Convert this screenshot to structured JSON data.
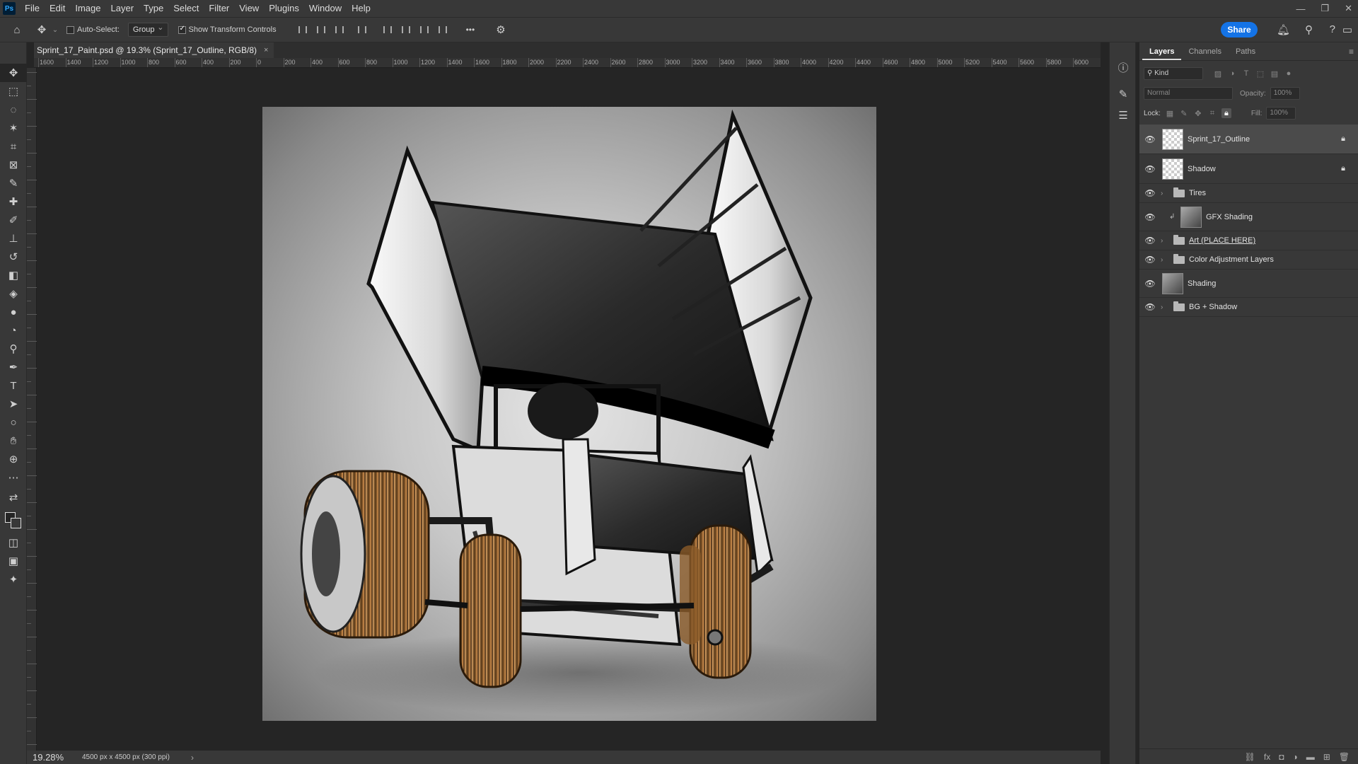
{
  "app": {
    "logo": "Ps"
  },
  "menu": [
    "File",
    "Edit",
    "Image",
    "Layer",
    "Type",
    "Select",
    "Filter",
    "View",
    "Plugins",
    "Window",
    "Help"
  ],
  "window_controls": {
    "minimize": "—",
    "restore": "❐",
    "close": "✕"
  },
  "options_bar": {
    "auto_select_label": "Auto-Select:",
    "auto_select_checked": false,
    "auto_select_mode": "Group",
    "show_transform_label": "Show Transform Controls",
    "show_transform_checked": true,
    "more_label": "•••",
    "share_label": "Share"
  },
  "document": {
    "tab_title": "Sprint_17_Paint.psd @ 19.3% (Sprint_17_Outline, RGB/8)",
    "close_glyph": "×"
  },
  "ruler": {
    "labels": [
      "1600",
      "1400",
      "1200",
      "1000",
      "800",
      "600",
      "400",
      "200",
      "0",
      "200",
      "400",
      "600",
      "800",
      "1000",
      "1200",
      "1400",
      "1600",
      "1800",
      "2000",
      "2200",
      "2400",
      "2600",
      "2800",
      "3000",
      "3200",
      "3400",
      "3600",
      "3800",
      "4000",
      "4200",
      "4400",
      "4600",
      "4800",
      "5000",
      "5200",
      "5400",
      "5600",
      "5800",
      "6000"
    ]
  },
  "status_bar": {
    "zoom": "19.28%",
    "doc_info": "4500 px x 4500 px (300 ppi)",
    "arrow": "›"
  },
  "layers_panel": {
    "tabs": [
      "Layers",
      "Channels",
      "Paths"
    ],
    "active_tab": "Layers",
    "filter_kind": "Kind",
    "blend_mode": "Normal",
    "opacity_label": "Opacity:",
    "opacity_value": "100%",
    "lock_label": "Lock:",
    "fill_label": "Fill:",
    "fill_value": "100%",
    "layers": [
      {
        "name": "Sprint_17_Outline",
        "type": "layer",
        "thumb": "transparent",
        "locked": true,
        "selected": true
      },
      {
        "name": "Shadow",
        "type": "layer",
        "thumb": "transparent",
        "locked": true,
        "selected": false
      },
      {
        "name": "Tires",
        "type": "group",
        "selected": false
      },
      {
        "name": "GFX Shading",
        "type": "clipped",
        "thumb": "image",
        "selected": false
      },
      {
        "name": "Art (PLACE HERE)",
        "type": "group",
        "underlined": true,
        "selected": false
      },
      {
        "name": "Color Adjustment Layers",
        "type": "group",
        "selected": false
      },
      {
        "name": "Shading",
        "type": "layer",
        "thumb": "image",
        "selected": false
      },
      {
        "name": "BG + Shadow",
        "type": "group",
        "selected": false
      }
    ]
  },
  "colors": {
    "accent": "#1473e6",
    "panel_bg": "#383838",
    "canvas_bg": "#252525",
    "tire": "#b5773a"
  },
  "artwork": {
    "subject": "sprint car illustration"
  }
}
